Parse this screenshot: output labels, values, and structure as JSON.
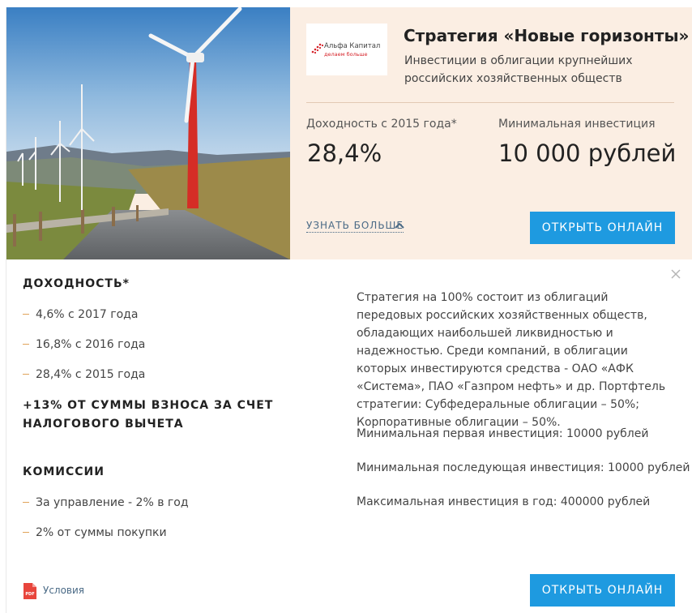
{
  "header": {
    "logo": {
      "name": "Альфа Капитал",
      "slogan": "делаем больше"
    },
    "title": "Стратегия «Новые горизонты»",
    "subtitle": "Инвестиции в облигации крупнейших российских хозяйственных обществ",
    "yield": {
      "label": "Доходность с 2015 года*",
      "value": "28,4%"
    },
    "min_investment": {
      "label": "Минимальная инвестиция",
      "value": "10 000 рублей"
    },
    "more_link": "УЗНАТЬ БОЛЬШЕ",
    "open_button": "ОТКРЫТЬ ОНЛАЙН"
  },
  "details": {
    "yield_heading": "ДОХОДНОСТЬ*",
    "yield_items": [
      "4,6% с 2017 года",
      "16,8% с 2016 года",
      "28,4% с 2015 года"
    ],
    "tax_bonus": "+13% ОТ СУММЫ ВЗНОСА ЗА СЧЕТ НАЛОГОВОГО ВЫЧЕТА",
    "fees_heading": "КОМИССИИ",
    "fees_items": [
      "За управление - 2% в год",
      "2% от суммы покупки"
    ],
    "description": "Стратегия на 100% состоит из облигаций передовых российских хозяйственных обществ, обладающих наибольшей ликвидностью и надежностью. Среди компаний, в облигации которых инвестируются средства - ОАО «АФК «Система», ПАО «Газпром нефть» и др. Портфтель стратегии: Субфедеральные облигации – 50%; Корпоративные облигации – 50%.",
    "min_first": "Минимальная первая инвестиция: 10000 рублей",
    "min_next": "Минимальная последующая инвестиция: 10000 рублей",
    "max_year": "Максимальная инвестиция в год: 400000 рублей",
    "pdf_label": "Условия",
    "pdf_icon_text": "PDF",
    "open_button": "ОТКРЫТЬ ОНЛАЙН"
  },
  "colors": {
    "accent": "#1e9ae0",
    "hero_bg": "#fbeee3",
    "bullet": "#e0a35a",
    "link": "#4a6a86",
    "brand_red": "#d6232a"
  }
}
